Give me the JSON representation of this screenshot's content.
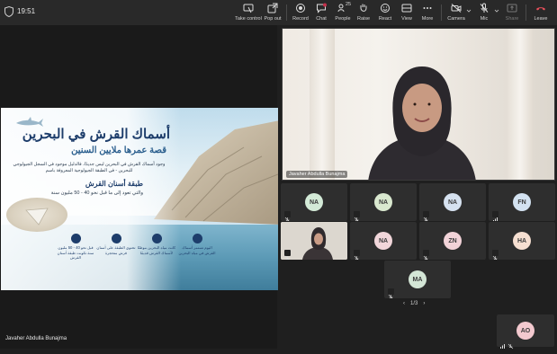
{
  "status": {
    "time": "19:51"
  },
  "toolbar": {
    "take_control": "Take control",
    "pop_out": "Pop out",
    "record": "Record",
    "chat": "Chat",
    "people": "People",
    "people_count": "25",
    "raise": "Raise",
    "react": "React",
    "view": "View",
    "more": "More",
    "camera": "Camera",
    "mic": "Mic",
    "share": "Share",
    "leave": "Leave"
  },
  "slide": {
    "title": "أسماك القرش في البحرين",
    "subtitle": "قصة عمرها ملايين السنين",
    "paragraph": "وجود أسماك القرش في البحرين ليس جديدًا، فالدليل موجود في السجل الجيولوجي للبحرين - في الطبقة الجيولوجية المعروفة باسم",
    "heading2": "طبقة أسنان القرش",
    "paragraph2": "والتي تعود إلى ما قبل نحو 40 - 50 مليون سنة",
    "facts": [
      "قبل نحو 40 - 50 مليون سنة تكونت طبقة أسنان القرش",
      "تحتوي الطبقة على أسنان قرش متحجرة",
      "كانت مياه البحرين موطنًا لأسماك القرش قديمًا",
      "اليوم تستمر أسماك القرش في مياه البحرين"
    ]
  },
  "presenter_name": "Javaher Abdulla Bunajma",
  "speaker_name": "Javaher Abdulla Bunajma",
  "participants": [
    {
      "initials": "NA",
      "color": "#d3ead7"
    },
    {
      "initials": "NA",
      "color": "#d9e8cf"
    },
    {
      "initials": "NA",
      "color": "#d6e2f0"
    },
    {
      "initials": "FN",
      "color": "#d3e2f1"
    },
    {
      "initials": "",
      "color": ""
    },
    {
      "initials": "NA",
      "color": "#f1d6da"
    },
    {
      "initials": "ZN",
      "color": "#f2d3d8"
    },
    {
      "initials": "HA",
      "color": "#f6dfd1"
    },
    {
      "initials": "MA",
      "color": "#d4e6d6"
    }
  ],
  "pager": {
    "text": "1/3"
  },
  "self_view": {
    "initials": "AO",
    "color": "#f3c9cf"
  }
}
